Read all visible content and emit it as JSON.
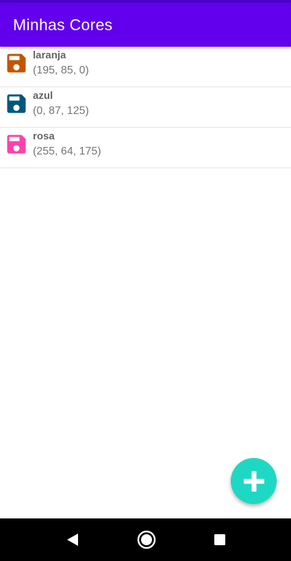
{
  "app_bar": {
    "title": "Minhas Cores"
  },
  "colors": [
    {
      "name": "laranja",
      "rgb_text": "(195, 85, 0)",
      "color": "#c35500"
    },
    {
      "name": "azul",
      "rgb_text": "(0, 87, 125)",
      "color": "#00577d"
    },
    {
      "name": "rosa",
      "rgb_text": "(255, 64, 175)",
      "color": "#ff40af"
    }
  ],
  "theme": {
    "primary": "#6200ee",
    "fab": "#1fd8c3"
  },
  "icons": {
    "item": "save-icon",
    "fab": "plus-icon",
    "nav_back": "back-triangle-icon",
    "nav_home": "home-circle-icon",
    "nav_recent": "recent-square-icon"
  }
}
